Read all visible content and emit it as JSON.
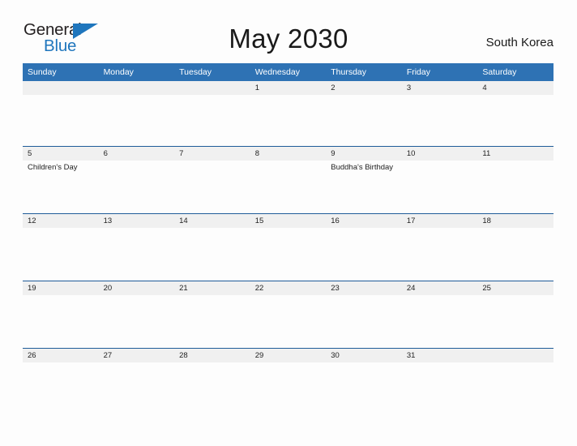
{
  "brand": {
    "name_part1": "General",
    "name_part2": "Blue",
    "triangle_icon": "triangle-icon"
  },
  "header": {
    "title": "May 2030",
    "locale": "South Korea"
  },
  "calendar": {
    "weekdays": [
      "Sunday",
      "Monday",
      "Tuesday",
      "Wednesday",
      "Thursday",
      "Friday",
      "Saturday"
    ],
    "weeks": [
      {
        "days": [
          {
            "num": "",
            "events": []
          },
          {
            "num": "",
            "events": []
          },
          {
            "num": "",
            "events": []
          },
          {
            "num": "1",
            "events": []
          },
          {
            "num": "2",
            "events": []
          },
          {
            "num": "3",
            "events": []
          },
          {
            "num": "4",
            "events": []
          }
        ]
      },
      {
        "days": [
          {
            "num": "5",
            "events": [
              "Children's Day"
            ]
          },
          {
            "num": "6",
            "events": []
          },
          {
            "num": "7",
            "events": []
          },
          {
            "num": "8",
            "events": []
          },
          {
            "num": "9",
            "events": [
              "Buddha's Birthday"
            ]
          },
          {
            "num": "10",
            "events": []
          },
          {
            "num": "11",
            "events": []
          }
        ]
      },
      {
        "days": [
          {
            "num": "12",
            "events": []
          },
          {
            "num": "13",
            "events": []
          },
          {
            "num": "14",
            "events": []
          },
          {
            "num": "15",
            "events": []
          },
          {
            "num": "16",
            "events": []
          },
          {
            "num": "17",
            "events": []
          },
          {
            "num": "18",
            "events": []
          }
        ]
      },
      {
        "days": [
          {
            "num": "19",
            "events": []
          },
          {
            "num": "20",
            "events": []
          },
          {
            "num": "21",
            "events": []
          },
          {
            "num": "22",
            "events": []
          },
          {
            "num": "23",
            "events": []
          },
          {
            "num": "24",
            "events": []
          },
          {
            "num": "25",
            "events": []
          }
        ]
      },
      {
        "days": [
          {
            "num": "26",
            "events": []
          },
          {
            "num": "27",
            "events": []
          },
          {
            "num": "28",
            "events": []
          },
          {
            "num": "29",
            "events": []
          },
          {
            "num": "30",
            "events": []
          },
          {
            "num": "31",
            "events": []
          },
          {
            "num": "",
            "events": []
          }
        ]
      }
    ]
  },
  "colors": {
    "header_blue": "#2e72b4",
    "rule_blue": "#1f5c99",
    "daynum_band": "#f0f0f0",
    "brand_blue": "#1f76bd",
    "page_bg": "#fdfdfd"
  }
}
